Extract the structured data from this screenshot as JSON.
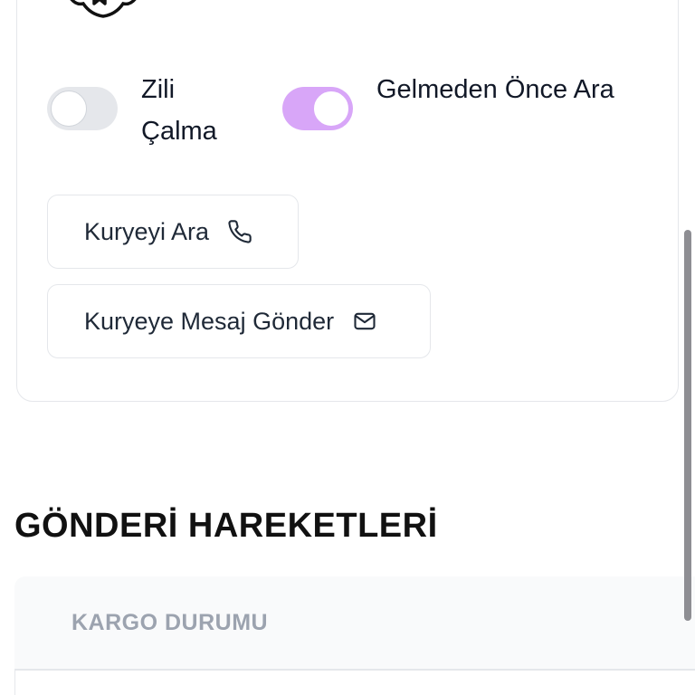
{
  "toggles": {
    "ring": {
      "label": "Zili Çalma",
      "on": false
    },
    "call_before": {
      "label": "Gelmeden Önce Ara",
      "on": true
    }
  },
  "buttons": {
    "call_courier": "Kuryeyi Ara",
    "message_courier": "Kuryeye Mesaj Gönder"
  },
  "section": {
    "title": "GÖNDERİ HAREKETLERİ",
    "table_header": "KARGO DURUMU"
  },
  "icons": {
    "badge": "badge-icon",
    "call": "phone-icon",
    "message": "mail-icon"
  },
  "colors": {
    "toggle_on": "#d8a6f8",
    "toggle_off": "#e5e7eb"
  }
}
